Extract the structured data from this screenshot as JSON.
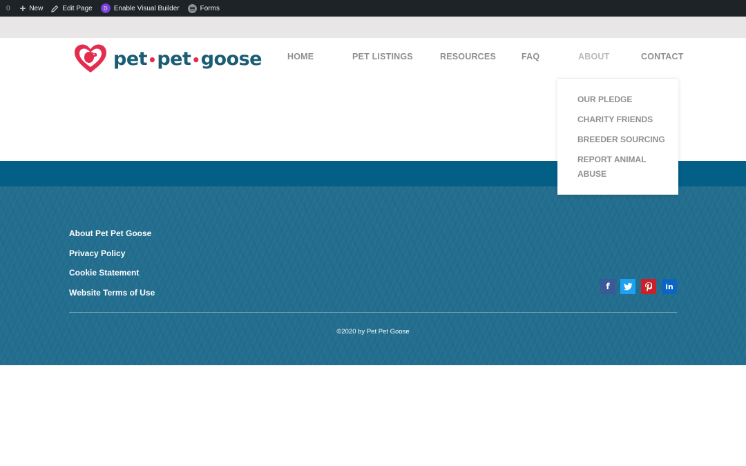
{
  "admin_bar": {
    "comment_count": "0",
    "new_label": "New",
    "edit_label": "Edit Page",
    "divi_letter": "D",
    "visual_builder_label": "Enable Visual Builder",
    "forms_label": "Forms"
  },
  "logo": {
    "word1": "pet",
    "word2": "pet",
    "word3": "goose",
    "dot": "•"
  },
  "nav": {
    "items": [
      {
        "label": "HOME"
      },
      {
        "label": "PET LISTINGS"
      },
      {
        "label": "RESOURCES"
      },
      {
        "label": "FAQ"
      },
      {
        "label": "ABOUT"
      },
      {
        "label": "CONTACT"
      }
    ],
    "dropdown": [
      {
        "label": "OUR PLEDGE"
      },
      {
        "label": "CHARITY FRIENDS"
      },
      {
        "label": "BREEDER SOURCING"
      },
      {
        "label": "REPORT ANIMAL ABUSE"
      }
    ]
  },
  "footer": {
    "links": [
      {
        "label": "About Pet Pet Goose"
      },
      {
        "label": "Privacy Policy"
      },
      {
        "label": "Cookie Statement"
      },
      {
        "label": "Website Terms of Use"
      }
    ],
    "social": [
      {
        "icon": "facebook-icon",
        "glyph": "f",
        "color": "#3b5998"
      },
      {
        "icon": "twitter-icon",
        "glyph": "t",
        "color": "#1da1f2"
      },
      {
        "icon": "pinterest-icon",
        "glyph": "p",
        "color": "#cb2027"
      },
      {
        "icon": "linkedin-icon",
        "glyph": "in",
        "color": "#0a66c2"
      }
    ],
    "copyright": "©2020 by Pet Pet Goose"
  },
  "colors": {
    "brand_teal": "#1a5c74",
    "brand_red": "#e42d4e",
    "band_blue": "#045f86",
    "footer_blue": "#236e8f"
  }
}
